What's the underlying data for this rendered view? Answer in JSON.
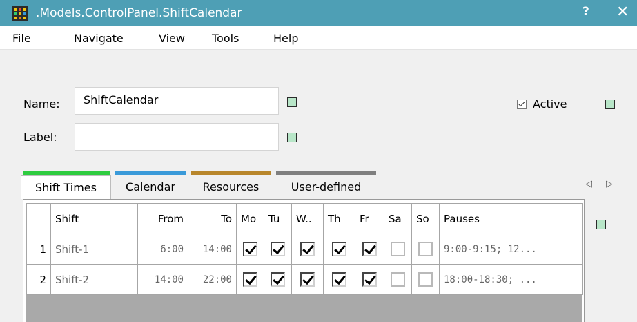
{
  "window": {
    "title": ".Models.ControlPanel.ShiftCalendar",
    "help_label": "?",
    "close_label": "✕"
  },
  "menu": [
    {
      "label": "File"
    },
    {
      "label": "Navigate"
    },
    {
      "label": "View"
    },
    {
      "label": "Tools"
    },
    {
      "label": "Help"
    }
  ],
  "form": {
    "name_label": "Name:",
    "name_value": "ShiftCalendar",
    "label_label": "Label:",
    "label_value": "",
    "active_label": "Active",
    "active_checked": true
  },
  "tabs": [
    {
      "label": "Shift Times",
      "color": "#2ecc40",
      "active": true
    },
    {
      "label": "Calendar",
      "color": "#3a9ad9",
      "active": false
    },
    {
      "label": "Resources",
      "color": "#b8862b",
      "active": false
    },
    {
      "label": "User-defined",
      "color": "#7f7f7f",
      "active": false
    }
  ],
  "tab_nav": {
    "prev": "◁",
    "next": "▷"
  },
  "grid": {
    "columns": [
      "Shift",
      "From",
      "To",
      "Mo",
      "Tu",
      "W..",
      "Th",
      "Fr",
      "Sa",
      "So",
      "Pauses"
    ],
    "rows": [
      {
        "index": "1",
        "shift": "Shift-1",
        "from": "6:00",
        "to": "14:00",
        "days": [
          true,
          true,
          true,
          true,
          true,
          false,
          false
        ],
        "pauses": "9:00-9:15; 12..."
      },
      {
        "index": "2",
        "shift": "Shift-2",
        "from": "14:00",
        "to": "22:00",
        "days": [
          true,
          true,
          true,
          true,
          true,
          false,
          false
        ],
        "pauses": "18:00-18:30; ..."
      }
    ]
  },
  "colors": {
    "titlebar": "#4e9fb5",
    "indicator_fill": "#b8e6c8",
    "grid_background": "#a9a9a9"
  }
}
